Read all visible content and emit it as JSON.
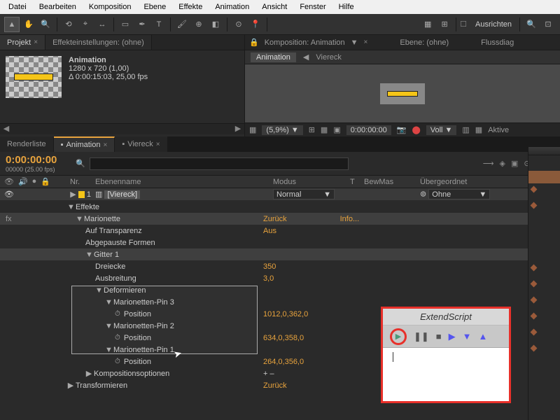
{
  "menu": [
    "Datei",
    "Bearbeiten",
    "Komposition",
    "Ebene",
    "Effekte",
    "Animation",
    "Ansicht",
    "Fenster",
    "Hilfe"
  ],
  "toolbar": {
    "ausrichten": "Ausrichten"
  },
  "project": {
    "tab_projekt": "Projekt",
    "tab_effekt": "Effekteinstellungen: (ohne)",
    "name": "Animation",
    "dims": "1280 x 720 (1,00)",
    "dur": "Δ 0:00:15:03, 25,00 fps"
  },
  "comp": {
    "label": "Komposition: Animation",
    "ebene": "Ebene: (ohne)",
    "fluss": "Flussdiag",
    "crumb_active": "Animation",
    "crumb_next": "Viereck",
    "zoom": "(5,9%)",
    "time": "0:00:00:00",
    "quality": "Voll",
    "aktive": "Aktive"
  },
  "tl": {
    "tab_render": "Renderliste",
    "tab_anim": "Animation",
    "tab_viereck": "Viereck",
    "timecode": "0:00:00:00",
    "fps": "00000 (25.00 fps)",
    "search_ph": "",
    "col_nr": "Nr.",
    "col_name": "Ebenenname",
    "col_mode": "Modus",
    "col_t": "T",
    "col_bew": "BewMas",
    "col_parent": "Übergeordnet",
    "layer_nr": "1",
    "layer_name": "[Viereck]",
    "mode_normal": "Normal",
    "parent_ohne": "Ohne",
    "effekte": "Effekte",
    "marionette": "Marionette",
    "zuruck": "Zurück",
    "info": "Info...",
    "auf_transparenz": "Auf Transparenz",
    "aus": "Aus",
    "abgepauste": "Abgepauste Formen",
    "gitter": "Gitter 1",
    "dreiecke": "Dreiecke",
    "dreiecke_v": "350",
    "ausbreitung": "Ausbreitung",
    "ausbreitung_v": "3,0",
    "deformieren": "Deformieren",
    "pin3": "Marionetten-Pin 3",
    "pin2": "Marionetten-Pin 2",
    "pin1": "Marionetten-Pin 1",
    "position": "Position",
    "pos3": "1012,0,362,0",
    "pos2": "634,0,358,0",
    "pos1": "264,0,356,0",
    "komp_opt": "Kompositionsoptionen",
    "komp_opt_v": "+ –",
    "transform": "Transformieren",
    "fx": "fx"
  },
  "extend": {
    "title": "ExtendScript"
  }
}
